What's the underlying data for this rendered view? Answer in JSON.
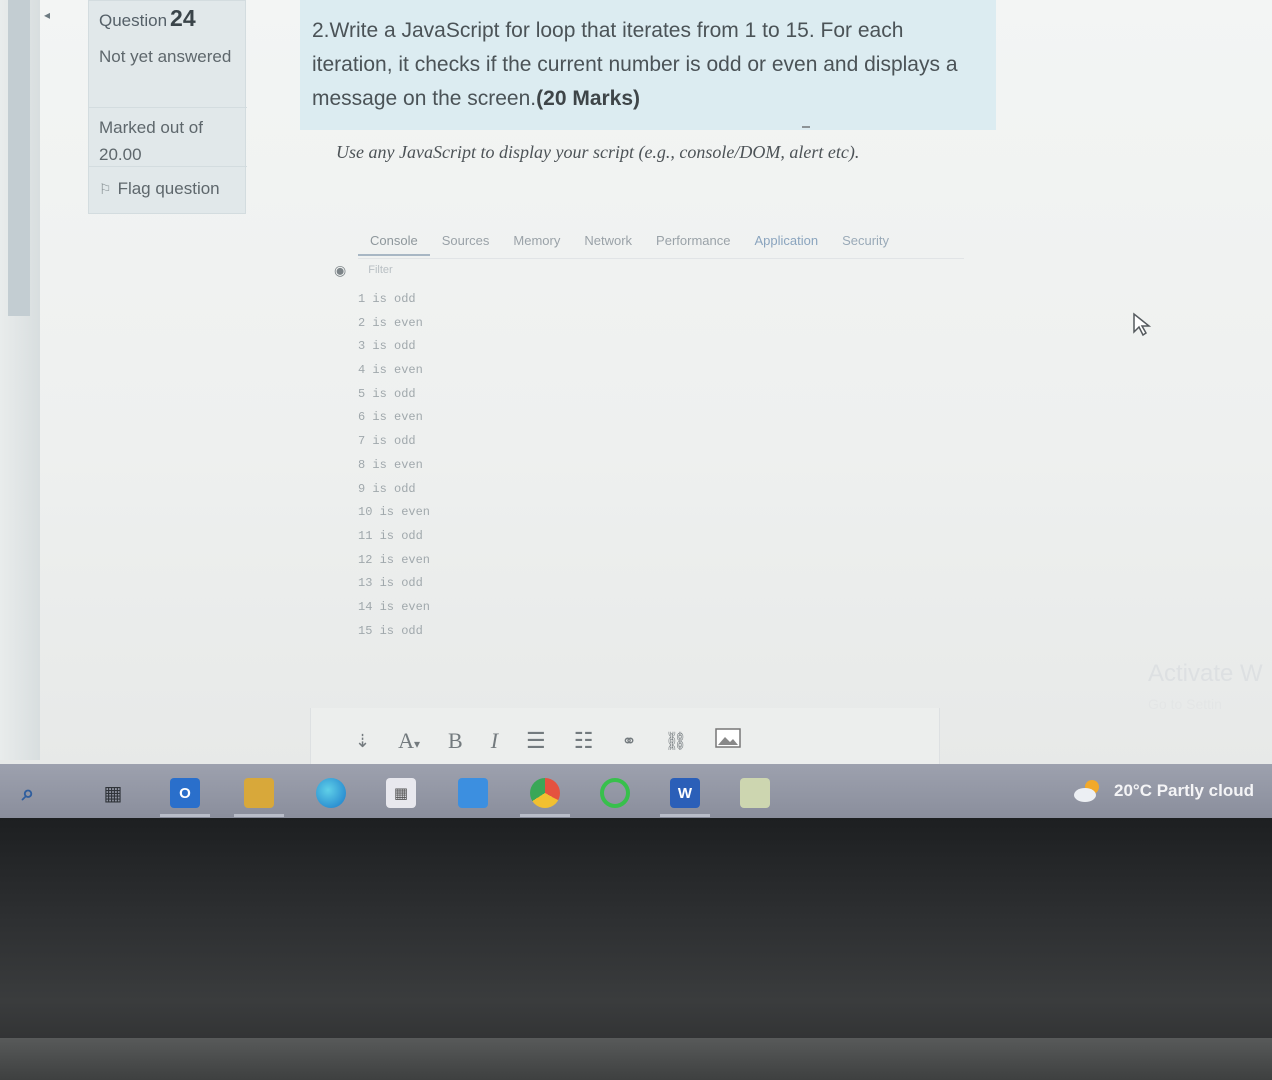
{
  "question_info": {
    "label": "Question",
    "number": "24",
    "status": "Not yet answered",
    "marks": "Marked out of 20.00",
    "flag": "Flag question"
  },
  "question": {
    "text": "2.Write a JavaScript for loop that iterates from 1 to 15. For each iteration, it checks if the current number is odd or even and displays a message on the screen.",
    "marks": "(20 Marks)",
    "instruction": "Use any JavaScript to display your script (e.g., console/DOM, alert etc)."
  },
  "devtools": {
    "tabs": [
      "Console",
      "Sources",
      "Memory",
      "Network",
      "Performance",
      "Application",
      "Security"
    ],
    "filter_placeholder": "Filter",
    "output": [
      "1 is odd",
      "2 is even",
      "3 is odd",
      "4 is even",
      "5 is odd",
      "6 is even",
      "7 is odd",
      "8 is even",
      "9 is odd",
      "10 is even",
      "11 is odd",
      "12 is even",
      "13 is odd",
      "14 is even",
      "15 is odd"
    ]
  },
  "editor_toolbar": {
    "expand": "⇣",
    "font": "A",
    "font_caret": "▾",
    "bold": "B",
    "italic": "I"
  },
  "watermark": {
    "line1": "Activate W",
    "line2": "Go to Settin"
  },
  "taskbar": {
    "weather": "20°C Partly cloud",
    "outlook_label": "O",
    "word_label": "W"
  },
  "icons": [
    "search-icon",
    "task-view-icon",
    "outlook-icon",
    "file-explorer-icon",
    "edge-icon",
    "store-icon",
    "mail-icon",
    "chrome-icon",
    "circle-app-icon",
    "word-icon",
    "notepad-icon",
    "weather-icon",
    "flag-icon",
    "eye-icon",
    "cursor-icon",
    "bullet-list-icon",
    "numbered-list-icon",
    "link-icon",
    "unlink-icon",
    "image-icon"
  ]
}
